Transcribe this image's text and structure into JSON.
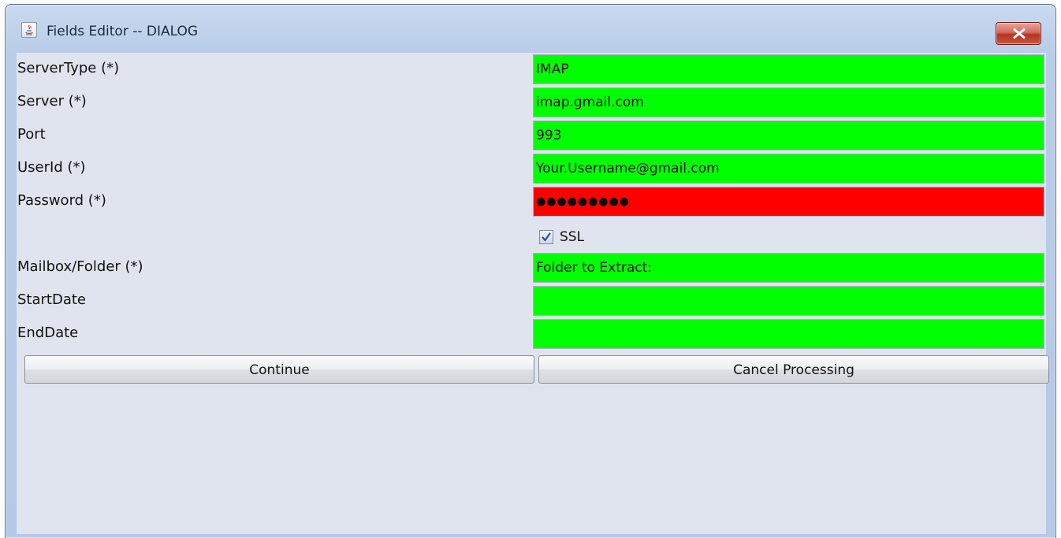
{
  "window": {
    "title": "Fields Editor -- DIALOG",
    "close_label": "×"
  },
  "fields": [
    {
      "label": "ServerType (*)",
      "value": "IMAP",
      "status": "valid"
    },
    {
      "label": "Server (*)",
      "value": "imap.gmail.com",
      "status": "valid"
    },
    {
      "label": "Port",
      "value": "993",
      "status": "valid"
    },
    {
      "label": "UserId (*)",
      "value": "Your.Username@gmail.com",
      "status": "valid"
    },
    {
      "label": "Password (*)",
      "value": "●●●●●●●●●",
      "status": "invalid"
    },
    {
      "label": "Mailbox/Folder (*)",
      "value": "Folder to Extract:",
      "status": "valid"
    },
    {
      "label": "StartDate",
      "value": "",
      "status": "valid"
    },
    {
      "label": "EndDate",
      "value": "",
      "status": "valid"
    }
  ],
  "ssl": {
    "label": "SSL",
    "checked": true
  },
  "buttons": {
    "continue": "Continue",
    "cancel": "Cancel Processing"
  },
  "colors": {
    "valid": "#00ff00",
    "invalid": "#ff0000",
    "background": "#dfe4ef"
  },
  "icons": {
    "app": "java-app-icon",
    "close": "close-icon",
    "check": "checkmark-icon"
  }
}
